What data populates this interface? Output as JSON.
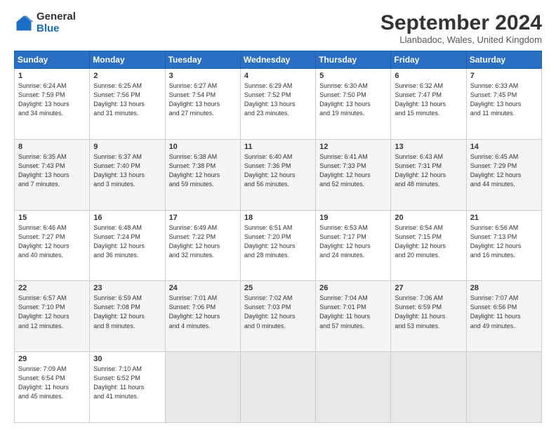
{
  "header": {
    "logo_general": "General",
    "logo_blue": "Blue",
    "title": "September 2024",
    "location": "Llanbadoc, Wales, United Kingdom"
  },
  "weekdays": [
    "Sunday",
    "Monday",
    "Tuesday",
    "Wednesday",
    "Thursday",
    "Friday",
    "Saturday"
  ],
  "weeks": [
    [
      {
        "day": "1",
        "info": "Sunrise: 6:24 AM\nSunset: 7:59 PM\nDaylight: 13 hours\nand 34 minutes."
      },
      {
        "day": "2",
        "info": "Sunrise: 6:25 AM\nSunset: 7:56 PM\nDaylight: 13 hours\nand 31 minutes."
      },
      {
        "day": "3",
        "info": "Sunrise: 6:27 AM\nSunset: 7:54 PM\nDaylight: 13 hours\nand 27 minutes."
      },
      {
        "day": "4",
        "info": "Sunrise: 6:29 AM\nSunset: 7:52 PM\nDaylight: 13 hours\nand 23 minutes."
      },
      {
        "day": "5",
        "info": "Sunrise: 6:30 AM\nSunset: 7:50 PM\nDaylight: 13 hours\nand 19 minutes."
      },
      {
        "day": "6",
        "info": "Sunrise: 6:32 AM\nSunset: 7:47 PM\nDaylight: 13 hours\nand 15 minutes."
      },
      {
        "day": "7",
        "info": "Sunrise: 6:33 AM\nSunset: 7:45 PM\nDaylight: 13 hours\nand 11 minutes."
      }
    ],
    [
      {
        "day": "8",
        "info": "Sunrise: 6:35 AM\nSunset: 7:43 PM\nDaylight: 13 hours\nand 7 minutes."
      },
      {
        "day": "9",
        "info": "Sunrise: 6:37 AM\nSunset: 7:40 PM\nDaylight: 13 hours\nand 3 minutes."
      },
      {
        "day": "10",
        "info": "Sunrise: 6:38 AM\nSunset: 7:38 PM\nDaylight: 12 hours\nand 59 minutes."
      },
      {
        "day": "11",
        "info": "Sunrise: 6:40 AM\nSunset: 7:36 PM\nDaylight: 12 hours\nand 56 minutes."
      },
      {
        "day": "12",
        "info": "Sunrise: 6:41 AM\nSunset: 7:33 PM\nDaylight: 12 hours\nand 52 minutes."
      },
      {
        "day": "13",
        "info": "Sunrise: 6:43 AM\nSunset: 7:31 PM\nDaylight: 12 hours\nand 48 minutes."
      },
      {
        "day": "14",
        "info": "Sunrise: 6:45 AM\nSunset: 7:29 PM\nDaylight: 12 hours\nand 44 minutes."
      }
    ],
    [
      {
        "day": "15",
        "info": "Sunrise: 6:46 AM\nSunset: 7:27 PM\nDaylight: 12 hours\nand 40 minutes."
      },
      {
        "day": "16",
        "info": "Sunrise: 6:48 AM\nSunset: 7:24 PM\nDaylight: 12 hours\nand 36 minutes."
      },
      {
        "day": "17",
        "info": "Sunrise: 6:49 AM\nSunset: 7:22 PM\nDaylight: 12 hours\nand 32 minutes."
      },
      {
        "day": "18",
        "info": "Sunrise: 6:51 AM\nSunset: 7:20 PM\nDaylight: 12 hours\nand 28 minutes."
      },
      {
        "day": "19",
        "info": "Sunrise: 6:53 AM\nSunset: 7:17 PM\nDaylight: 12 hours\nand 24 minutes."
      },
      {
        "day": "20",
        "info": "Sunrise: 6:54 AM\nSunset: 7:15 PM\nDaylight: 12 hours\nand 20 minutes."
      },
      {
        "day": "21",
        "info": "Sunrise: 6:56 AM\nSunset: 7:13 PM\nDaylight: 12 hours\nand 16 minutes."
      }
    ],
    [
      {
        "day": "22",
        "info": "Sunrise: 6:57 AM\nSunset: 7:10 PM\nDaylight: 12 hours\nand 12 minutes."
      },
      {
        "day": "23",
        "info": "Sunrise: 6:59 AM\nSunset: 7:08 PM\nDaylight: 12 hours\nand 8 minutes."
      },
      {
        "day": "24",
        "info": "Sunrise: 7:01 AM\nSunset: 7:06 PM\nDaylight: 12 hours\nand 4 minutes."
      },
      {
        "day": "25",
        "info": "Sunrise: 7:02 AM\nSunset: 7:03 PM\nDaylight: 12 hours\nand 0 minutes."
      },
      {
        "day": "26",
        "info": "Sunrise: 7:04 AM\nSunset: 7:01 PM\nDaylight: 11 hours\nand 57 minutes."
      },
      {
        "day": "27",
        "info": "Sunrise: 7:06 AM\nSunset: 6:59 PM\nDaylight: 11 hours\nand 53 minutes."
      },
      {
        "day": "28",
        "info": "Sunrise: 7:07 AM\nSunset: 6:56 PM\nDaylight: 11 hours\nand 49 minutes."
      }
    ],
    [
      {
        "day": "29",
        "info": "Sunrise: 7:09 AM\nSunset: 6:54 PM\nDaylight: 11 hours\nand 45 minutes."
      },
      {
        "day": "30",
        "info": "Sunrise: 7:10 AM\nSunset: 6:52 PM\nDaylight: 11 hours\nand 41 minutes."
      },
      {
        "day": "",
        "info": ""
      },
      {
        "day": "",
        "info": ""
      },
      {
        "day": "",
        "info": ""
      },
      {
        "day": "",
        "info": ""
      },
      {
        "day": "",
        "info": ""
      }
    ]
  ]
}
